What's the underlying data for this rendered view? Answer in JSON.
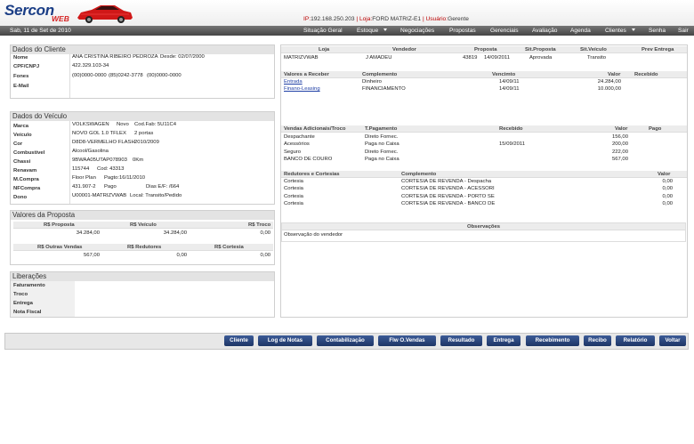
{
  "header": {
    "logo_text": "Sercon",
    "logo_sub": "WEB",
    "ip_label": "IP:",
    "ip": "192.168.250.203",
    "loja_label": "Loja:",
    "loja": "FORD MATRIZ-E1",
    "usuario_label": "Usuário:",
    "usuario": "Gerente",
    "accent": "#1b3e86"
  },
  "nav": {
    "date": "Sab, 11 de Set de 2010",
    "items": [
      "Situação Geral",
      "Estoque",
      "Negociações",
      "Propostas",
      "Gerenciais",
      "Avaliação",
      "Agenda",
      "Clientes",
      "Senha",
      "Sair"
    ]
  },
  "cliente": {
    "title": "Dados do Cliente",
    "nome_label": "Nome",
    "nome": "ANA CRISTINA RIBEIRO PEDROZA",
    "desde": "Desde: 02/07/2000",
    "cpf_label": "CPF/CNPJ",
    "cpf": "422.329.103-34",
    "fones_label": "Fones",
    "fone1": "(00)0000-0000",
    "fone2": "(85)0242-3778",
    "fone3": "(00)0000-0000",
    "email_label": "E-Mail"
  },
  "veiculo": {
    "title": "Dados do Veículo",
    "marca_label": "Marca",
    "marca": "VOLKSWAGEN",
    "marca2": "Novo",
    "marca3": "Cod.Fab: 5U11C4",
    "veiculo_label": "Veículo",
    "veiculo": "NOVO GOL 1.0 TFLEX",
    "veiculo2": "2 portas",
    "cor_label": "Cor",
    "cor": "D8D8-VERMELHO FLASH",
    "cor2": "2010/2009",
    "comb_label": "Combustível",
    "comb": "Alcool/Gasolina",
    "chassi_label": "Chassi",
    "chassi": "9BWAA05UTAP078903",
    "chassi2": "0Km",
    "renavam_label": "Renavam",
    "renavam": "115744",
    "renavam2": "Cod: 43313",
    "mcompra_label": "M.Compra",
    "mcompra": "Floor Plan",
    "mcompra2": "Pagto:16/11/2010",
    "nf_label": "NFCompra",
    "nf": "431.907-2",
    "nf2": "Pago",
    "nf3": "Dias E/F: /664",
    "dono_label": "Dono",
    "dono": "U00001-MATRIZVWAB",
    "dono2": "Local: Transito/Pedido"
  },
  "valores": {
    "title": "Valores da Proposta",
    "h1": "R$ Proposta",
    "h2": "R$ Veículo",
    "h3": "R$ Troco",
    "v1": "34.284,00",
    "v2": "34.284,00",
    "v3": "0,00",
    "h4": "R$ Outras Vendas",
    "h5": "R$ Redutores",
    "h6": "R$ Cortesia",
    "v4": "567,00",
    "v5": "0,00",
    "v6": "0,00"
  },
  "liberacoes": {
    "title": "Liberações",
    "items": [
      "Faturamento",
      "Troco",
      "Entrega",
      "Nota Fiscal"
    ]
  },
  "proposta": {
    "headers": [
      "Loja",
      "Vendedor",
      "Proposta",
      "Sit.Proposta",
      "Sit.Veículo",
      "Prev Entrega"
    ],
    "row": [
      "MATRIZVWAB",
      "J AMADEU",
      "43819",
      "14/09/2011",
      "Aprovada",
      "Transito"
    ]
  },
  "receber": {
    "headers": [
      "Valores a Receber",
      "Complemento",
      "Vencimto",
      "Valor",
      "Recebido"
    ],
    "rows": [
      [
        "Entrada",
        "Dinheiro",
        "14/09/11",
        "24.284,00",
        ""
      ],
      [
        "Finano-Leasing",
        "FINANCIAMENTO",
        "14/09/11",
        "10.000,00",
        ""
      ]
    ]
  },
  "vendas": {
    "headers": [
      "Vendas Adicionais/Troco",
      "T.Pagamento",
      "Recebido",
      "Valor",
      "Pago"
    ],
    "rows": [
      [
        "Despachante",
        "Direto Fornec.",
        "",
        "156,00",
        ""
      ],
      [
        "Acessórios",
        "Paga no Caixa",
        "15/09/2011",
        "200,00",
        ""
      ],
      [
        "Seguro",
        "Direto Fornec.",
        "",
        "222,00",
        ""
      ],
      [
        "BANCO DE COURO",
        "Paga no Caixa",
        "",
        "567,00",
        ""
      ]
    ]
  },
  "redutores": {
    "headers": [
      "Redutores e Cortesias",
      "Complemento",
      "Valor"
    ],
    "rows": [
      [
        "Cortesia",
        "CORTESIA DE REVENDA - Despacha",
        "0,00"
      ],
      [
        "Cortesia",
        "CORTESIA DE REVENDA - ACESSORI",
        "0,00"
      ],
      [
        "Cortesia",
        "CORTESIA DE REVENDA - PORTO SE",
        "0,00"
      ],
      [
        "Cortesia",
        "CORTESIA DE REVENDA - BANCO DE",
        "0,00"
      ]
    ]
  },
  "observacoes": {
    "title": "Observações",
    "text": "Observação do vendedor"
  },
  "buttons": [
    "Cliente",
    "Log de Notas",
    "Contabilização",
    "Flw O.Vendas",
    "Resultado",
    "Entrega",
    "Recebimento",
    "Recibo",
    "Relatório",
    "Voltar"
  ]
}
